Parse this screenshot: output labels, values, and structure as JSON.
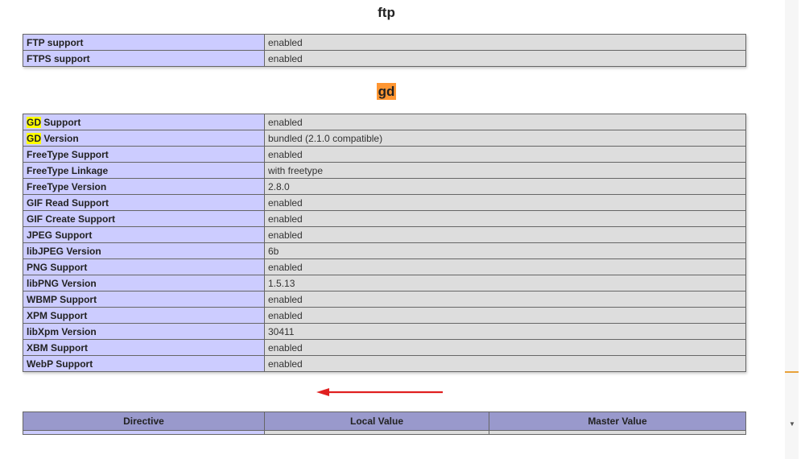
{
  "ftp": {
    "title": "ftp",
    "rows": [
      {
        "name": "FTP support",
        "value": "enabled"
      },
      {
        "name": "FTPS support",
        "value": "enabled"
      }
    ]
  },
  "gd": {
    "title": "gd",
    "rows": [
      {
        "name_hl": "GD",
        "name": " Support",
        "value": "enabled"
      },
      {
        "name_hl": "GD",
        "name": " Version",
        "value": "bundled (2.1.0 compatible)"
      },
      {
        "name": "FreeType Support",
        "value": "enabled"
      },
      {
        "name": "FreeType Linkage",
        "value": "with freetype"
      },
      {
        "name": "FreeType Version",
        "value": "2.8.0"
      },
      {
        "name": "GIF Read Support",
        "value": "enabled"
      },
      {
        "name": "GIF Create Support",
        "value": "enabled"
      },
      {
        "name": "JPEG Support",
        "value": "enabled"
      },
      {
        "name": "libJPEG Version",
        "value": "6b"
      },
      {
        "name": "PNG Support",
        "value": "enabled"
      },
      {
        "name": "libPNG Version",
        "value": "1.5.13"
      },
      {
        "name": "WBMP Support",
        "value": "enabled"
      },
      {
        "name": "XPM Support",
        "value": "enabled"
      },
      {
        "name": "libXpm Version",
        "value": "30411"
      },
      {
        "name": "XBM Support",
        "value": "enabled"
      },
      {
        "name": "WebP Support",
        "value": "enabled"
      }
    ]
  },
  "directives": {
    "headers": [
      "Directive",
      "Local Value",
      "Master Value"
    ]
  },
  "annotation": {
    "arrow_color": "#e02020"
  },
  "scrollbar": {
    "down_icon": "scroll-down-arrow-icon",
    "down_glyph": "▼"
  }
}
